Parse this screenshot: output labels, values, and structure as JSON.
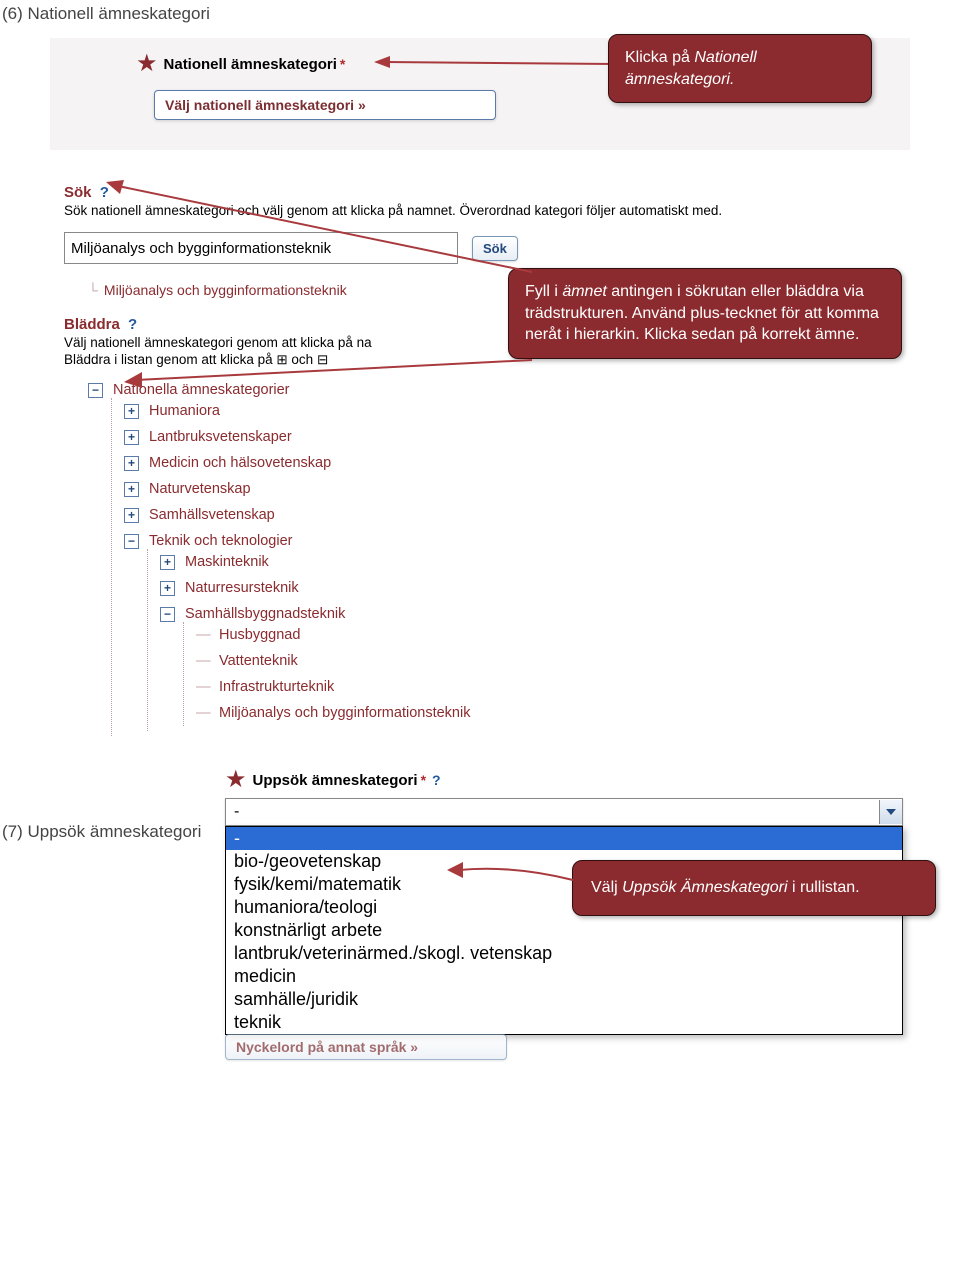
{
  "section6": {
    "label": "(6) Nationell ämneskategori",
    "title": "Nationell ämneskategori",
    "asterisk": "*",
    "select_button": "Välj nationell ämneskategori »",
    "callout1": "Klicka på <em>Nationell ämneskategori.</em>"
  },
  "search": {
    "header": "Sök",
    "q": "?",
    "desc": "Sök nationell ämneskategori och välj genom att klicka på namnet. Överordnad kategori följer automatiskt med.",
    "value": "Miljöanalys och bygginformationsteknik",
    "button": "Sök",
    "result": "Miljöanalys och bygginformationsteknik",
    "browse_header": "Bläddra",
    "browse_desc1": "Välj nationell ämneskategori genom att klicka på na",
    "browse_desc2": "Bläddra i listan genom att klicka på ⊞ och ⊟",
    "callout2": "Fyll i <em>ämnet</em> antingen i sökrutan eller bläddra via trädstrukturen. Använd plus-tecknet för att komma neråt i hierarkin. Klicka sedan på korrekt  ämne."
  },
  "tree": {
    "root": "Nationella ämneskategorier",
    "items": [
      {
        "label": "Humaniora",
        "state": "+"
      },
      {
        "label": "Lantbruksvetenskaper",
        "state": "+"
      },
      {
        "label": "Medicin och hälsovetenskap",
        "state": "+"
      },
      {
        "label": "Naturvetenskap",
        "state": "+"
      },
      {
        "label": "Samhällsvetenskap",
        "state": "+"
      },
      {
        "label": "Teknik och teknologier",
        "state": "-",
        "children": [
          {
            "label": "Maskinteknik",
            "state": "+"
          },
          {
            "label": "Naturresursteknik",
            "state": "+"
          },
          {
            "label": "Samhällsbyggnadsteknik",
            "state": "-",
            "children": [
              {
                "label": "Husbyggnad"
              },
              {
                "label": "Vattenteknik"
              },
              {
                "label": "Infrastrukturteknik"
              },
              {
                "label": "Miljöanalys och bygginformationsteknik"
              }
            ]
          }
        ]
      }
    ]
  },
  "section7": {
    "label": "(7) Uppsök ämneskategori",
    "title": "Uppsök ämneskategori",
    "asterisk": "*",
    "q": "?",
    "selected": "-",
    "options": [
      "-",
      "bio-/geovetenskap",
      "fysik/kemi/matematik",
      "humaniora/teologi",
      "konstnärligt arbete",
      "lantbruk/veterinärmed./skogl. vetenskap",
      "medicin",
      "samhälle/juridik",
      "teknik"
    ],
    "behind_button": "Nyckelord på annat språk »",
    "callout3": "Välj <em>Uppsök Ämneskategori</em>  i rullistan."
  }
}
